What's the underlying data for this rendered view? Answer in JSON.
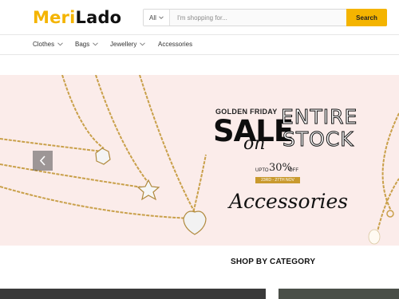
{
  "header": {
    "logo_part1": "Meri",
    "logo_part2": "Lado",
    "search_category": "All",
    "search_placeholder": "I'm shopping for...",
    "search_button": "Search"
  },
  "nav": {
    "items": [
      {
        "label": "Clothes"
      },
      {
        "label": "Bags"
      },
      {
        "label": "Jewellery"
      },
      {
        "label": "Accessories"
      }
    ]
  },
  "banner": {
    "golden_friday": "GOLDEN FRIDAY",
    "sale": "SALE",
    "on": "on",
    "entire": "ENTIRE",
    "stock": "STOCK",
    "upto": "UPTO",
    "percent": "30%",
    "off": "OFF",
    "dates": "23RD - 27TH NOV",
    "category": "Accessories"
  },
  "section": {
    "title": "SHOP BY CATEGORY"
  },
  "colors": {
    "brand": "#f4b400",
    "banner_bg": "#fbecea",
    "gold": "#c99a2e"
  },
  "icons": [
    "chevron-down-icon",
    "chevron-left-icon"
  ]
}
